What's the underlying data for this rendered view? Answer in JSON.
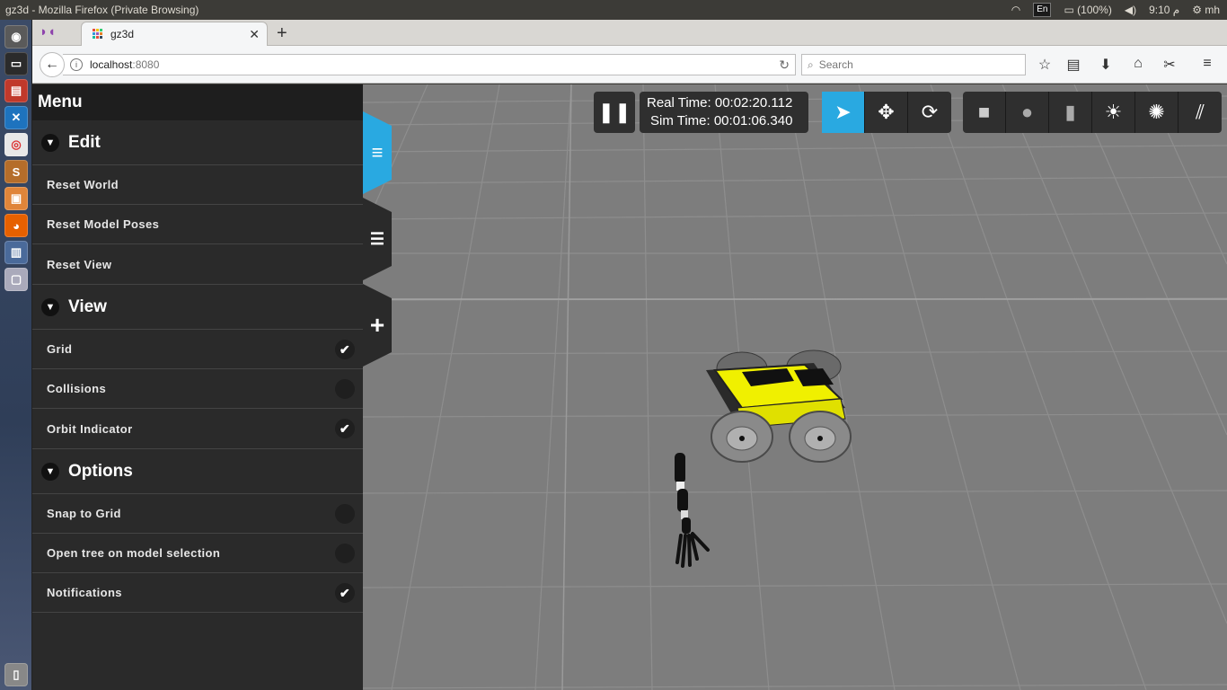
{
  "os": {
    "window_title": "gz3d - Mozilla Firefox (Private Browsing)",
    "keyboard": "En",
    "battery": "(100%)",
    "clock": "9:10 م",
    "user": "mh"
  },
  "browser": {
    "tab_title": "gz3d",
    "url_host": "localhost",
    "url_port": ":8080",
    "search_placeholder": "Search"
  },
  "menu": {
    "title": "Menu",
    "sections": [
      {
        "label": "Edit",
        "items": [
          {
            "label": "Reset World"
          },
          {
            "label": "Reset Model Poses"
          },
          {
            "label": "Reset View"
          }
        ]
      },
      {
        "label": "View",
        "items": [
          {
            "label": "Grid",
            "checked": true
          },
          {
            "label": "Collisions",
            "checked": false
          },
          {
            "label": "Orbit Indicator",
            "checked": true
          }
        ]
      },
      {
        "label": "Options",
        "items": [
          {
            "label": "Snap to Grid",
            "checked": false
          },
          {
            "label": "Open tree on model selection",
            "checked": false
          },
          {
            "label": "Notifications",
            "checked": true
          }
        ]
      }
    ]
  },
  "toolbar": {
    "real_time": "Real Time: 00:02:20.112",
    "sim_time": "Sim Time: 00:01:06.340"
  },
  "colors": {
    "accent": "#29a9e1",
    "robot_body": "#f0f000",
    "ground": "#7d7d7d"
  }
}
